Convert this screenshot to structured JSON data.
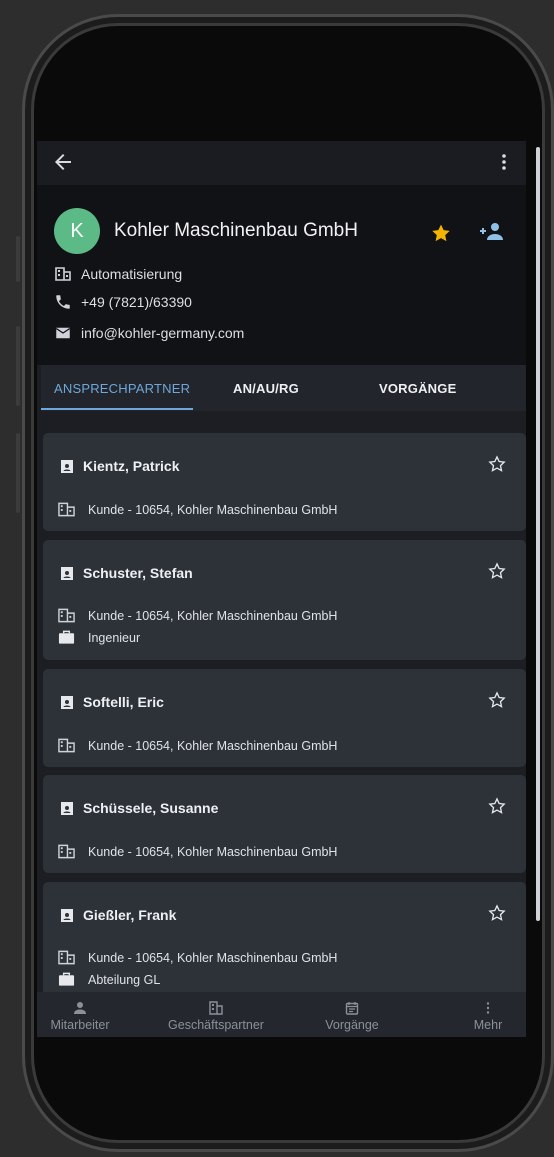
{
  "appbar": {
    "back_icon": "arrow-left-icon",
    "menu_icon": "more-vert-icon"
  },
  "company": {
    "avatar_letter": "K",
    "avatar_color": "#5cba86",
    "name": "Kohler Maschinenbau GmbH",
    "favorite": true,
    "favorite_color": "#f4b400",
    "industry": "Automatisierung",
    "phone": "+49 (7821)/63390",
    "email": "info@kohler-germany.com"
  },
  "tabs": [
    {
      "label": "ANSPRECHPARTNER",
      "active": true
    },
    {
      "label": "AN/AU/RG",
      "active": false
    },
    {
      "label": "VORGÄNGE",
      "active": false
    }
  ],
  "contacts": [
    {
      "name": "Kientz, Patrick",
      "company_line": "Kunde - 10654, Kohler Maschinenbau GmbH",
      "role": ""
    },
    {
      "name": "Schuster, Stefan",
      "company_line": "Kunde - 10654, Kohler Maschinenbau GmbH",
      "role": "Ingenieur"
    },
    {
      "name": "Softelli, Eric",
      "company_line": "Kunde - 10654, Kohler Maschinenbau GmbH",
      "role": ""
    },
    {
      "name": "Schüssele, Susanne",
      "company_line": "Kunde - 10654, Kohler Maschinenbau GmbH",
      "role": ""
    },
    {
      "name": "Gießler, Frank",
      "company_line": "Kunde - 10654, Kohler Maschinenbau GmbH",
      "role": "Abteilung GL"
    }
  ],
  "bottom_nav": [
    {
      "label": "Mitarbeiter",
      "icon": "person-icon"
    },
    {
      "label": "Geschäftspartner",
      "icon": "building-icon"
    },
    {
      "label": "Vorgänge",
      "icon": "calendar-icon"
    },
    {
      "label": "Mehr",
      "icon": "more-vert-icon"
    }
  ],
  "colors": {
    "accent": "#6ea8d8",
    "surface": "#2d3239",
    "background": "#1c1e23"
  }
}
